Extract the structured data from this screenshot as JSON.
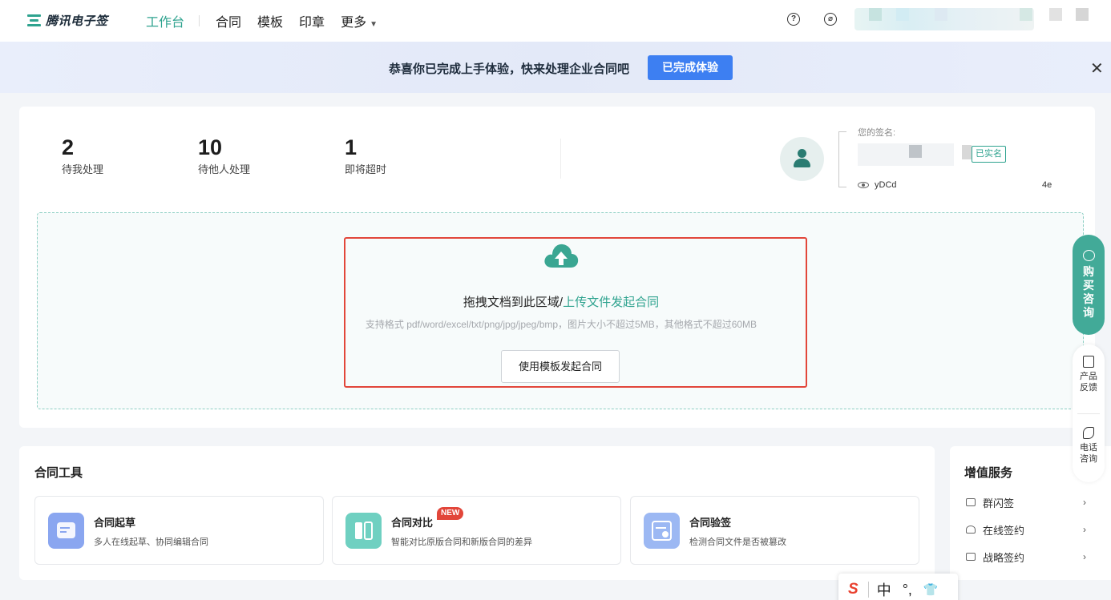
{
  "app": {
    "name": "腾讯电子签"
  },
  "nav": {
    "items": [
      {
        "label": "工作台"
      },
      {
        "label": "合同"
      },
      {
        "label": "模板"
      },
      {
        "label": "印章"
      },
      {
        "label": "更多"
      }
    ],
    "help_icon": "question-circle-icon",
    "link_icon": "link-icon"
  },
  "banner": {
    "message": "恭喜你已完成上手体验，快来处理企业合同吧",
    "button": "已完成体验",
    "close_icon": "close-icon"
  },
  "stats": [
    {
      "value": "2",
      "label": "待我处理"
    },
    {
      "value": "10",
      "label": "待他人处理"
    },
    {
      "value": "1",
      "label": "即将超时"
    }
  ],
  "signature": {
    "label": "您的签名:",
    "verified_badge": "已实名",
    "id_prefix": "yDCd",
    "id_suffix": "4e"
  },
  "upload": {
    "title_prefix": "拖拽文档到此区域/",
    "title_link": "上传文件发起合同",
    "hint": "支持格式 pdf/word/excel/txt/png/jpg/jpeg/bmp，图片大小不超过5MB，其他格式不超过60MB",
    "template_button": "使用模板发起合同"
  },
  "tools": {
    "title": "合同工具",
    "items": [
      {
        "title": "合同起草",
        "desc": "多人在线起草、协同编辑合同",
        "color": "#8aa6f0"
      },
      {
        "title": "合同对比",
        "desc": "智能对比原版合同和新版合同的差异",
        "badge": "NEW",
        "color": "#6fd0c1"
      },
      {
        "title": "合同验签",
        "desc": "检测合同文件是否被篡改",
        "color": "#9cb8f3"
      }
    ]
  },
  "services": {
    "title": "增值服务",
    "items": [
      {
        "label": "群闪签"
      },
      {
        "label": "在线签约"
      },
      {
        "label": "战略签约"
      }
    ]
  },
  "float": {
    "buy": "购买咨询",
    "feedback_1": "产品",
    "feedback_2": "反馈",
    "phone_1": "电话",
    "phone_2": "咨询"
  },
  "ime": {
    "mode": "中",
    "punct": "°,",
    "skin": "👕"
  },
  "colors": {
    "brand": "#2fa38f",
    "primary": "#3d7ff2",
    "danger": "#e2463a"
  }
}
